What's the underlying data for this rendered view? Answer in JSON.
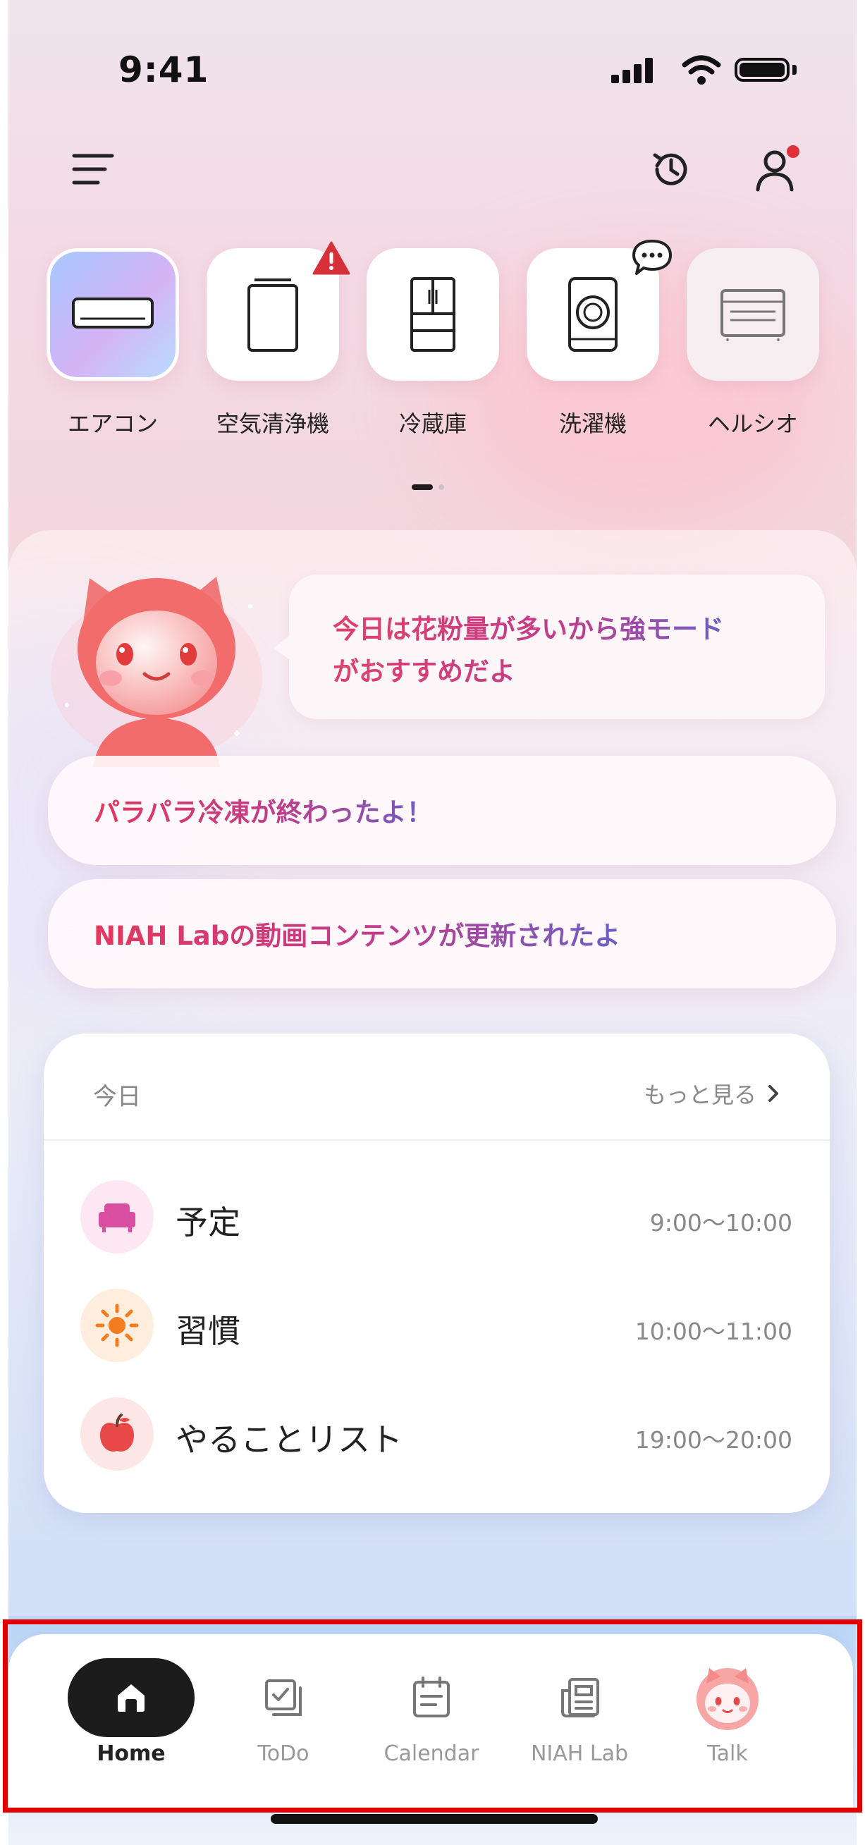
{
  "status_bar": {
    "time": "9:41"
  },
  "devices": [
    {
      "label": "エアコン",
      "icon": "air-conditioner-icon",
      "active": true,
      "badge": null
    },
    {
      "label": "空気清浄機",
      "icon": "air-purifier-icon",
      "active": false,
      "badge": "warning-icon"
    },
    {
      "label": "冷蔵庫",
      "icon": "refrigerator-icon",
      "active": false,
      "badge": null
    },
    {
      "label": "洗濯機",
      "icon": "washing-machine-icon",
      "active": false,
      "badge": "chat-bubble-icon"
    },
    {
      "label": "ヘルシオ",
      "icon": "microwave-oven-icon",
      "active": false,
      "badge": null
    }
  ],
  "assistant": {
    "message_line1": "今日は花粉量が多いから強モード",
    "message_line2": "がおすすめだよ"
  },
  "notifications": [
    {
      "text": "パラパラ冷凍が終わったよ！"
    },
    {
      "text": "NIAH Labの動画コンテンツが更新されたよ"
    }
  ],
  "today": {
    "title": "今日",
    "more_label": "もっと見る",
    "items": [
      {
        "name": "予定",
        "time": "9:00～10:00",
        "icon": "sofa-icon",
        "icon_bg": "#fde7f2",
        "icon_color": "#d94ea0"
      },
      {
        "name": "習慣",
        "time": "10:00～11:00",
        "icon": "sun-icon",
        "icon_bg": "#ffeedd",
        "icon_color": "#f47c20"
      },
      {
        "name": "やることリスト",
        "time": "19:00～20:00",
        "icon": "apple-icon",
        "icon_bg": "#fde6e6",
        "icon_color": "#e84848"
      }
    ]
  },
  "tabs": [
    {
      "label": "Home",
      "icon": "home-icon",
      "active": true
    },
    {
      "label": "ToDo",
      "icon": "todo-icon",
      "active": false
    },
    {
      "label": "Calendar",
      "icon": "calendar-icon",
      "active": false
    },
    {
      "label": "NIAH Lab",
      "icon": "news-icon",
      "active": false
    },
    {
      "label": "Talk",
      "icon": "mascot-avatar-icon",
      "active": false
    }
  ],
  "colors": {
    "accent_red": "#e0303a",
    "highlight_border": "#e00000",
    "dark": "#1c1c1c"
  }
}
